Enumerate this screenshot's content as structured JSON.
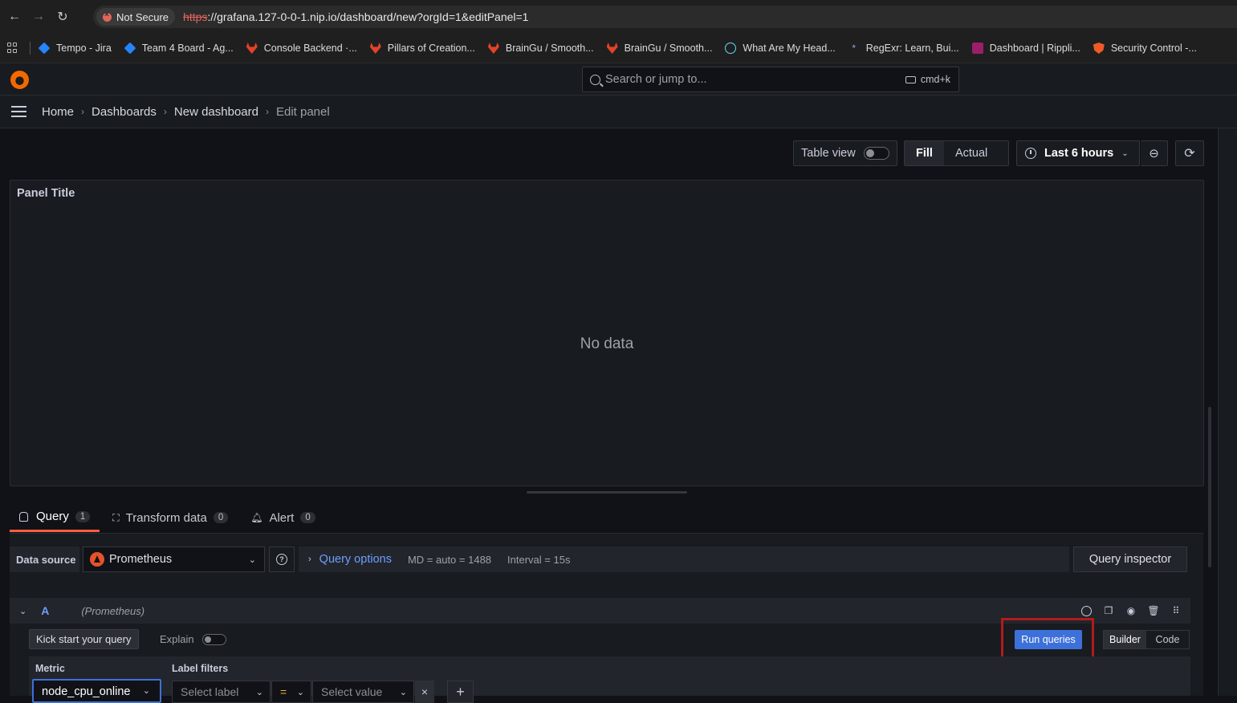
{
  "browser": {
    "security_label": "Not Secure",
    "url_scheme": "https",
    "url_rest": "://grafana.127-0-0-1.nip.io/dashboard/new?orgId=1&editPanel=1"
  },
  "bookmarks": [
    {
      "label": "Tempo - Jira",
      "icon": "jira-icon"
    },
    {
      "label": "Team 4 Board - Ag...",
      "icon": "jira-icon"
    },
    {
      "label": "Console Backend ·...",
      "icon": "gitlab-icon"
    },
    {
      "label": "Pillars of Creation...",
      "icon": "gitlab-icon"
    },
    {
      "label": "BrainGu / Smooth...",
      "icon": "gitlab-icon"
    },
    {
      "label": "BrainGu / Smooth...",
      "icon": "gitlab-icon"
    },
    {
      "label": "What Are My Head...",
      "icon": "react-icon"
    },
    {
      "label": "RegExr: Learn, Bui...",
      "icon": "regexr-icon"
    },
    {
      "label": "Dashboard | Rippli...",
      "icon": "ripple-icon"
    },
    {
      "label": "Security Control -...",
      "icon": "shield-icon"
    }
  ],
  "search": {
    "placeholder": "Search or jump to...",
    "shortcut": "cmd+k"
  },
  "breadcrumb": {
    "home": "Home",
    "dashboards": "Dashboards",
    "dashboard": "New dashboard",
    "current": "Edit panel"
  },
  "toolbar": {
    "table_view": "Table view",
    "fill": "Fill",
    "actual": "Actual",
    "time_range": "Last 6 hours"
  },
  "panel": {
    "title": "Panel Title",
    "no_data": "No data"
  },
  "tabs": [
    {
      "label": "Query",
      "count": "1"
    },
    {
      "label": "Transform data",
      "count": "0"
    },
    {
      "label": "Alert",
      "count": "0"
    }
  ],
  "query": {
    "data_source_label": "Data source",
    "data_source": "Prometheus",
    "options_label": "Query options",
    "md": "MD = auto = 1488",
    "interval": "Interval = 15s",
    "inspector": "Query inspector",
    "ref_id": "A",
    "ds_name": "(Prometheus)",
    "kick_start": "Kick start your query",
    "explain": "Explain",
    "run": "Run queries",
    "mode_builder": "Builder",
    "mode_code": "Code",
    "metric_label": "Metric",
    "metric_value": "node_cpu_online",
    "label_filters": "Label filters",
    "select_label": "Select label",
    "operator": "=",
    "select_value": "Select value"
  },
  "colors": {
    "accent_blue": "#3d71d9",
    "highlight_red": "#b31b1b",
    "tab_underline": "#f55f3e"
  }
}
